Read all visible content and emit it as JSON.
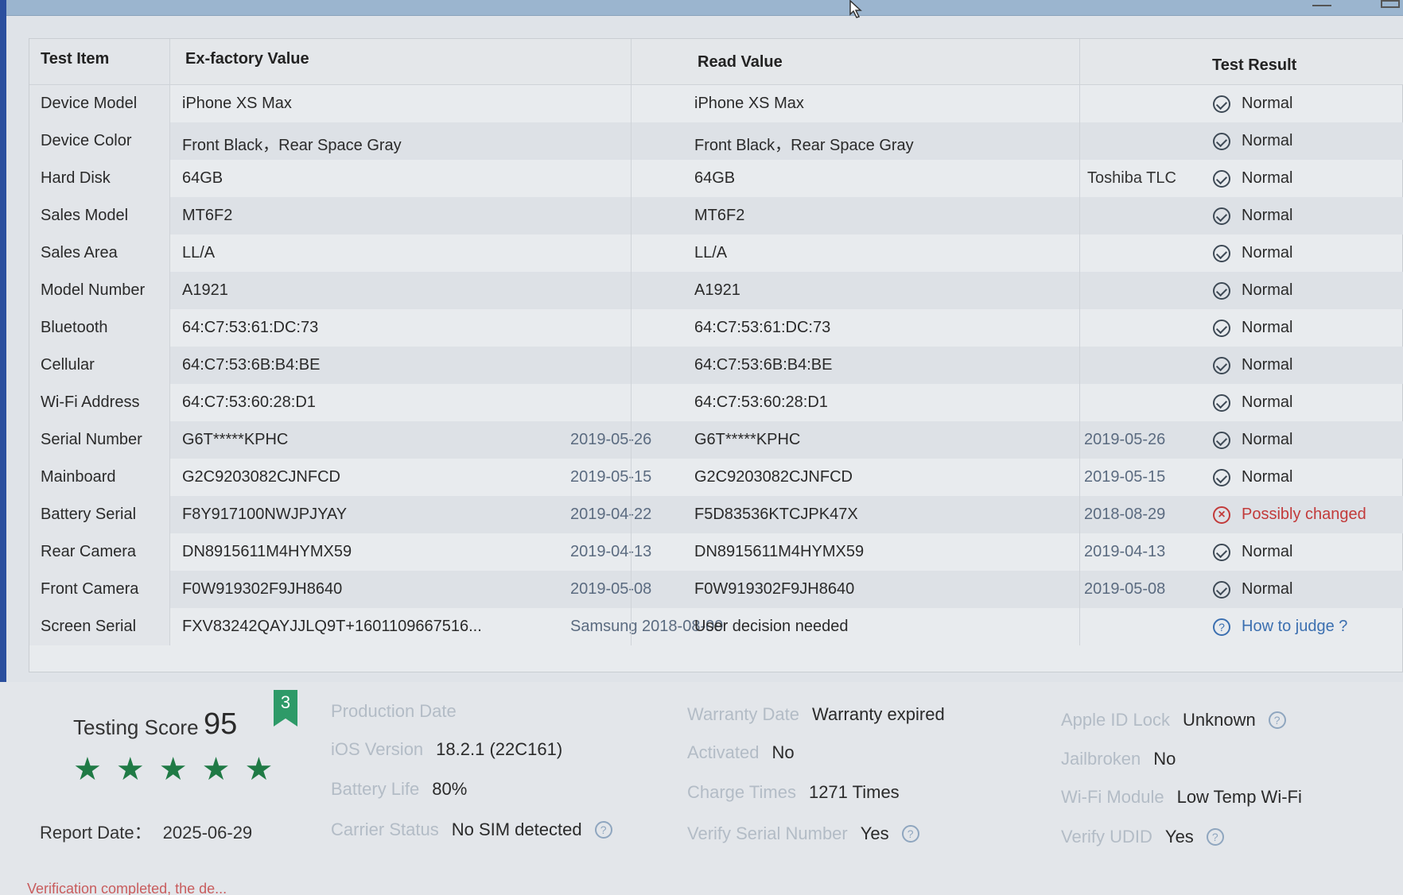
{
  "header": {
    "item": "Test Item",
    "ex": "Ex-factory Value",
    "read": "Read Value",
    "result": "Test Result"
  },
  "rows": [
    {
      "item": "Device Model",
      "ex": "iPhone XS Max",
      "ex_date": "",
      "read": "iPhone XS Max",
      "read_date": "",
      "read_extra": "",
      "result": "Normal",
      "status": "ok"
    },
    {
      "item": "Device Color",
      "ex": "Front Black，Rear Space Gray",
      "ex_date": "",
      "read": "Front Black，Rear Space Gray",
      "read_date": "",
      "read_extra": "",
      "result": "Normal",
      "status": "ok"
    },
    {
      "item": "Hard Disk",
      "ex": "64GB",
      "ex_date": "",
      "read": "64GB",
      "read_date": "",
      "read_extra": "Toshiba TLC",
      "result": "Normal",
      "status": "ok"
    },
    {
      "item": "Sales Model",
      "ex": "MT6F2",
      "ex_date": "",
      "read": "MT6F2",
      "read_date": "",
      "read_extra": "",
      "result": "Normal",
      "status": "ok"
    },
    {
      "item": "Sales Area",
      "ex": "LL/A",
      "ex_date": "",
      "read": "LL/A",
      "read_date": "",
      "read_extra": "",
      "result": "Normal",
      "status": "ok"
    },
    {
      "item": "Model Number",
      "ex": "A1921",
      "ex_date": "",
      "read": "A1921",
      "read_date": "",
      "read_extra": "",
      "result": "Normal",
      "status": "ok"
    },
    {
      "item": "Bluetooth",
      "ex": "64:C7:53:61:DC:73",
      "ex_date": "",
      "read": "64:C7:53:61:DC:73",
      "read_date": "",
      "read_extra": "",
      "result": "Normal",
      "status": "ok"
    },
    {
      "item": "Cellular",
      "ex": "64:C7:53:6B:B4:BE",
      "ex_date": "",
      "read": "64:C7:53:6B:B4:BE",
      "read_date": "",
      "read_extra": "",
      "result": "Normal",
      "status": "ok"
    },
    {
      "item": "Wi-Fi Address",
      "ex": "64:C7:53:60:28:D1",
      "ex_date": "",
      "read": "64:C7:53:60:28:D1",
      "read_date": "",
      "read_extra": "",
      "result": "Normal",
      "status": "ok"
    },
    {
      "item": "Serial Number",
      "ex": "G6T*****KPHC",
      "ex_date": "2019-05-26",
      "read": "G6T*****KPHC",
      "read_date": "2019-05-26",
      "read_extra": "",
      "result": "Normal",
      "status": "ok"
    },
    {
      "item": "Mainboard",
      "ex": "G2C9203082CJNFCD",
      "ex_date": "2019-05-15",
      "read": "G2C9203082CJNFCD",
      "read_date": "2019-05-15",
      "read_extra": "",
      "result": "Normal",
      "status": "ok"
    },
    {
      "item": "Battery Serial",
      "ex": "F8Y917100NWJPJYAY",
      "ex_date": "2019-04-22",
      "read": "F5D83536KTCJPK47X",
      "read_date": "2018-08-29",
      "read_extra": "",
      "result": "Possibly changed",
      "status": "bad"
    },
    {
      "item": "Rear Camera",
      "ex": "DN8915611M4HYMX59",
      "ex_date": "2019-04-13",
      "read": "DN8915611M4HYMX59",
      "read_date": "2019-04-13",
      "read_extra": "",
      "result": "Normal",
      "status": "ok"
    },
    {
      "item": "Front Camera",
      "ex": "F0W919302F9JH8640",
      "ex_date": "2019-05-08",
      "read": "F0W919302F9JH8640",
      "read_date": "2019-05-08",
      "read_extra": "",
      "result": "Normal",
      "status": "ok"
    },
    {
      "item": "Screen Serial",
      "ex": "FXV83242QAYJJLQ9T+1601109667516...",
      "ex_date": "Samsung 2018-08-09",
      "read": "User decision needed",
      "read_date": "",
      "read_extra": "",
      "result": "How to judge ?",
      "status": "help"
    }
  ],
  "summary": {
    "score_label": "Testing Score",
    "score": "95",
    "badge": "3",
    "stars": "5 of 5",
    "report_label": "Report Date：",
    "report_date": "2025-06-29",
    "production_date_label": "Production Date",
    "production_date": "",
    "ios_label": "iOS Version",
    "ios": "18.2.1 (22C161)",
    "battery_label": "Battery Life",
    "battery": "80%",
    "carrier_label": "Carrier Status",
    "carrier": "No SIM detected",
    "warranty_label": "Warranty Date",
    "warranty": "Warranty expired",
    "activated_label": "Activated",
    "activated": "No",
    "charge_label": "Charge Times",
    "charge": "1271 Times",
    "verify_serial_label": "Verify Serial Number",
    "verify_serial": "Yes",
    "appleid_label": "Apple ID Lock",
    "appleid": "Unknown",
    "jailbroken_label": "Jailbroken",
    "jailbroken": "No",
    "wifi_label": "Wi-Fi Module",
    "wifi": "Low Temp Wi-Fi",
    "udid_label": "Verify UDID",
    "udid": "Yes",
    "footer": "Verification completed, the de..."
  }
}
